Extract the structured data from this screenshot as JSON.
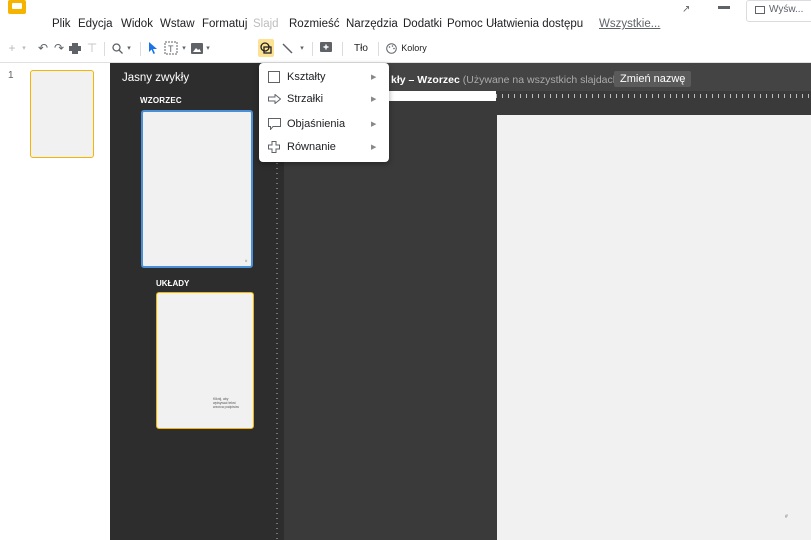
{
  "menubar": {
    "items": [
      {
        "label": "Plik"
      },
      {
        "label": "Edycja"
      },
      {
        "label": "Widok"
      },
      {
        "label": "Wstaw"
      },
      {
        "label": "Formatuj"
      },
      {
        "label": "Slajd",
        "disabled": true
      },
      {
        "label": "Rozmieść"
      },
      {
        "label": "Narzędzia"
      },
      {
        "label": "Dodatki"
      },
      {
        "label": "Pomoc"
      },
      {
        "label": "Ułatwienia dostępu"
      },
      {
        "label": "Wszystkie..."
      }
    ],
    "share_partial": "Wyśw..."
  },
  "toolbar": {
    "background_label": "Tło",
    "colors_label": "Kolory",
    "icons": [
      "add-icon",
      "undo-icon",
      "redo-icon",
      "print-icon",
      "paint-format-icon",
      "zoom-icon",
      "select-icon",
      "textbox-icon",
      "image-icon",
      "shape-icon",
      "line-icon",
      "comment-icon"
    ]
  },
  "filmstrip": {
    "slide_number": "1"
  },
  "master_panel": {
    "title": "Jasny zwykły",
    "master_label": "WZORZEC",
    "layouts_label": "UKŁADY",
    "layout_thumb_text": "Klknij, aby wpisywać tekst wzorca podpisów"
  },
  "editor": {
    "title_main": "kły – Wzorzec",
    "title_muted": "(Używane na wszystkich slajdach)",
    "rename_button": "Zmień nazwę",
    "page_num": "#"
  },
  "dropdown": {
    "items": [
      {
        "label": "Kształty",
        "icon": "square-icon"
      },
      {
        "label": "Strzałki",
        "icon": "arrow-icon"
      },
      {
        "label": "Objaśnienia",
        "icon": "callout-icon"
      },
      {
        "label": "Równanie",
        "icon": "plus-icon"
      }
    ]
  },
  "colors": {
    "accent": "#f4b400",
    "selection_blue": "#4a90d9",
    "panel_dark": "#2d2d2d"
  }
}
